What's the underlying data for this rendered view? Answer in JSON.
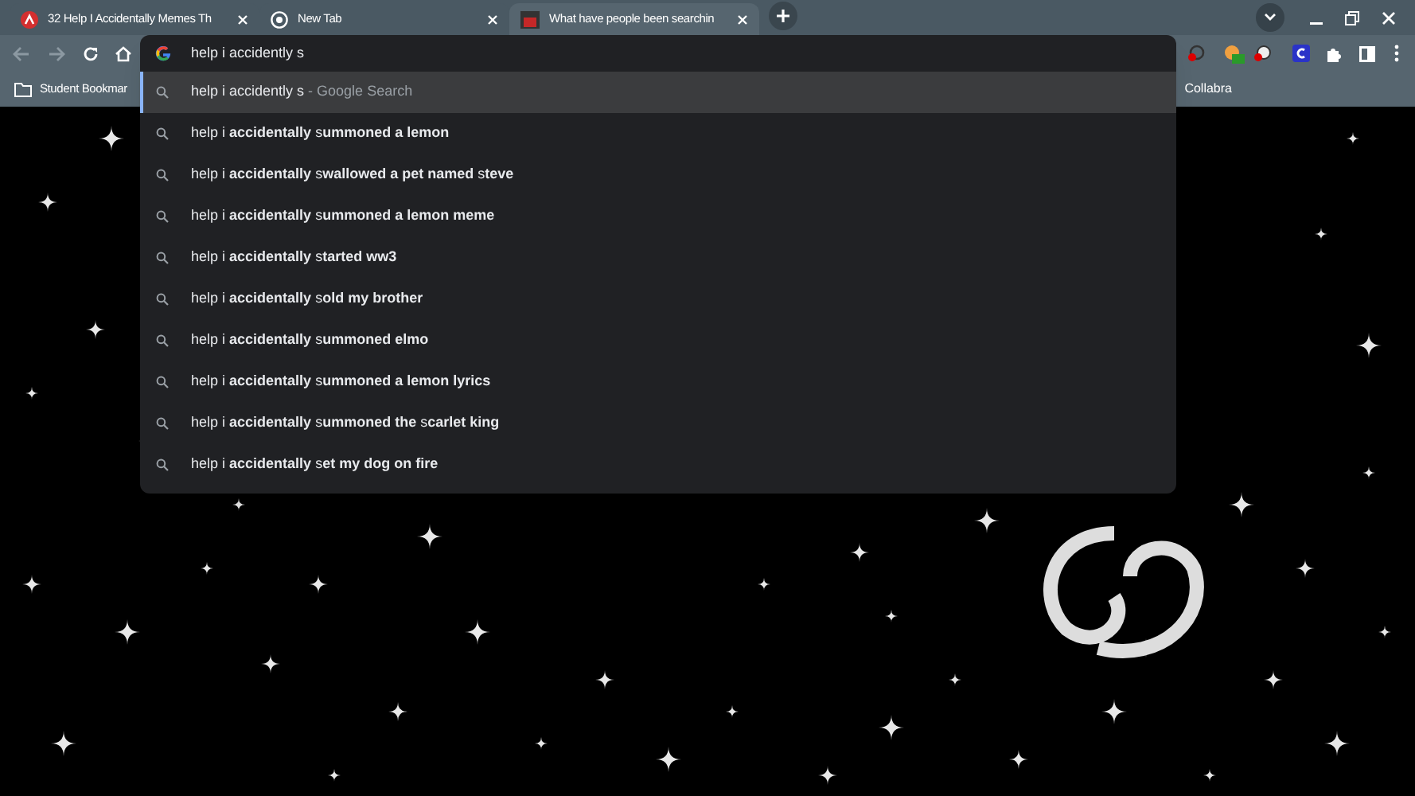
{
  "tabs": [
    {
      "title": "32 Help I Accidentally Memes Th",
      "selected": false
    },
    {
      "title": "New Tab",
      "selected": false
    },
    {
      "title": "What have people been searchin",
      "selected": true
    }
  ],
  "omnibox": {
    "value": "help i accidently s"
  },
  "suggestions": [
    {
      "kind": "search",
      "text": "help i accidently s",
      "hint": " - Google Search",
      "selected": true
    },
    {
      "kind": "suggestion",
      "text": "help i **accidentally** s**ummoned a lemon**",
      "selected": false
    },
    {
      "kind": "suggestion",
      "text": "help i **accidentally** s**wallowed a pet named** s**teve**",
      "selected": false
    },
    {
      "kind": "suggestion",
      "text": "help i **accidentally** s**ummoned a lemon meme**",
      "selected": false
    },
    {
      "kind": "suggestion",
      "text": "help i **accidentally** s**tarted ww3**",
      "selected": false
    },
    {
      "kind": "suggestion",
      "text": "help i **accidentally** s**old my brother**",
      "selected": false
    },
    {
      "kind": "suggestion",
      "text": "help i **accidentally** s**ummoned elmo**",
      "selected": false
    },
    {
      "kind": "suggestion",
      "text": "help i **accidentally** s**ummoned a lemon lyrics**",
      "selected": false
    },
    {
      "kind": "suggestion",
      "text": "help i **accidentally** s**ummoned the** s**carlet king**",
      "selected": false
    },
    {
      "kind": "suggestion",
      "text": "help i **accidentally** s**et my dog on fire**",
      "selected": false
    }
  ],
  "bookmarks": [
    {
      "label": "Student Bookmar"
    },
    {
      "label": "Collabra"
    }
  ]
}
